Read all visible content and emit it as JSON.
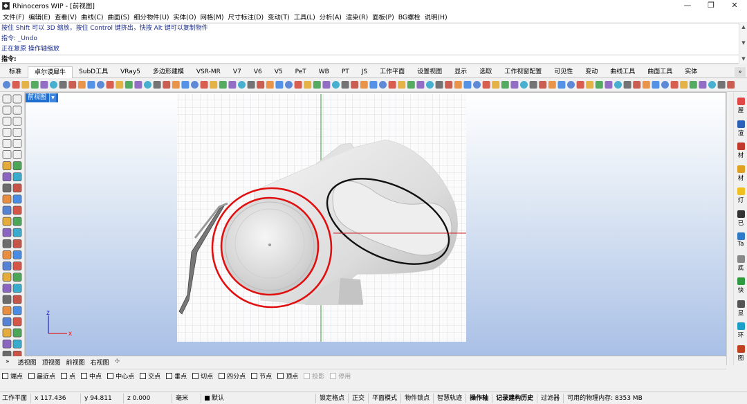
{
  "window": {
    "title": "Rhinoceros WIP - [前视图]",
    "min": "—",
    "max": "❐",
    "close": "✕"
  },
  "menu": [
    "文件(F)",
    "编辑(E)",
    "查看(V)",
    "曲线(C)",
    "曲面(S)",
    "细分物件(U)",
    "实体(O)",
    "网格(M)",
    "尺寸标注(D)",
    "变动(T)",
    "工具(L)",
    "分析(A)",
    "渲染(R)",
    "面板(P)",
    "BG螺栓",
    "说明(H)"
  ],
  "command_history": [
    "按住 Shift 可以 3D 缩放，按住 Control 键挤出，快按 Alt 键可以复制物件",
    "指令: _Undo",
    "正在复原 操作轴缩放"
  ],
  "command_prompt": "指令:",
  "tabs": [
    "标准",
    "卓尔谟犀牛",
    "SubD工具",
    "VRay5",
    "多边形建模",
    "VSR-MR",
    "V7",
    "V6",
    "V5",
    "PeT",
    "WB",
    "PT",
    "JS",
    "工作平面",
    "设置视图",
    "显示",
    "选取",
    "工作视窗配置",
    "可见性",
    "变动",
    "曲线工具",
    "曲面工具",
    "实体"
  ],
  "active_tab": "卓尔谟犀牛",
  "tab_more": "»",
  "viewport": {
    "label": "前视图",
    "axis_x": "x",
    "axis_z": "z"
  },
  "right_panel": [
    "屋",
    "渲",
    "材",
    "材",
    "灯",
    "已",
    "Ta",
    "底",
    "快",
    "显",
    "环",
    "图"
  ],
  "viewport_tabs": [
    "透视图",
    "顶视图",
    "前视图",
    "右视图"
  ],
  "viewport_tabs_prefix": "»",
  "viewport_tab_add": "✣",
  "osnaps": [
    {
      "label": "端点",
      "enabled": true
    },
    {
      "label": "最近点",
      "enabled": true
    },
    {
      "label": "点",
      "enabled": true
    },
    {
      "label": "中点",
      "enabled": true
    },
    {
      "label": "中心点",
      "enabled": true
    },
    {
      "label": "交点",
      "enabled": true
    },
    {
      "label": "垂点",
      "enabled": true
    },
    {
      "label": "切点",
      "enabled": true
    },
    {
      "label": "四分点",
      "enabled": true
    },
    {
      "label": "节点",
      "enabled": true
    },
    {
      "label": "顶点",
      "enabled": true
    },
    {
      "label": "投影",
      "enabled": false
    },
    {
      "label": "停用",
      "enabled": false
    }
  ],
  "status": {
    "cplane": "工作平面",
    "x": "x 117.436",
    "y": "y 94.811",
    "z": "z 0.000",
    "unit": "毫米",
    "layer": "默认",
    "toggles": [
      "锁定格点",
      "正交",
      "平面模式",
      "物件锁点",
      "智慧轨迹",
      "操作轴",
      "记录建构历史",
      "过滤器"
    ],
    "bold_toggles": [
      "操作轴",
      "记录建构历史"
    ],
    "memory": "可用的物理内存: 8353 MB"
  },
  "colors": {
    "accent": "#1e6ecf",
    "history_text": "#1c2e8c",
    "circle": "#e01010",
    "ellipse": "#111111"
  }
}
